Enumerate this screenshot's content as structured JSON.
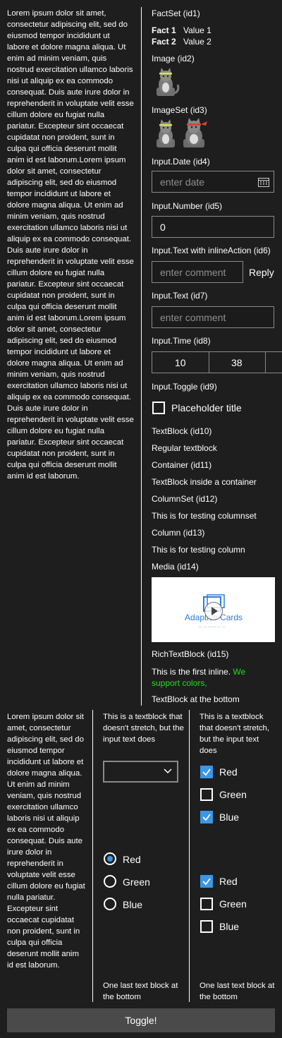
{
  "lorem_block": "Lorem ipsum dolor sit amet, consectetur adipiscing elit, sed do eiusmod tempor incididunt ut labore et dolore magna aliqua. Ut enim ad minim veniam, quis nostrud exercitation ullamco laboris nisi ut aliquip ex ea commodo consequat. Duis aute irure dolor in reprehenderit in voluptate velit esse cillum dolore eu fugiat nulla pariatur. Excepteur sint occaecat cupidatat non proident, sunt in culpa qui officia deserunt mollit anim id est laborum.Lorem ipsum dolor sit amet, consectetur adipiscing elit, sed do eiusmod tempor incididunt ut labore et dolore magna aliqua. Ut enim ad minim veniam, quis nostrud exercitation ullamco laboris nisi ut aliquip ex ea commodo consequat. Duis aute irure dolor in reprehenderit in voluptate velit esse cillum dolore eu fugiat nulla pariatur. Excepteur sint occaecat cupidatat non proident, sunt in culpa qui officia deserunt mollit anim id est laborum.Lorem ipsum dolor sit amet, consectetur adipiscing elit, sed do eiusmod tempor incididunt ut labore et dolore magna aliqua. Ut enim ad minim veniam, quis nostrud exercitation ullamco laboris nisi ut aliquip ex ea commodo consequat. Duis aute irure dolor in reprehenderit in voluptate velit esse cillum dolore eu fugiat nulla pariatur. Excepteur sint occaecat cupidatat non proident, sunt in culpa qui officia deserunt mollit anim id est laborum.",
  "lorem_short": "Lorem ipsum dolor sit amet, consectetur adipiscing elit, sed do eiusmod tempor incididunt ut labore et dolore magna aliqua. Ut enim ad minim veniam, quis nostrud exercitation ullamco laboris nisi ut aliquip ex ea commodo consequat. Duis aute irure dolor in reprehenderit in voluptate velit esse cillum dolore eu fugiat nulla pariatur. Excepteur sint occaecat cupidatat non proident, sunt in culpa qui officia deserunt mollit anim id est laborum.",
  "factset": {
    "heading": "FactSet (id1)",
    "facts": [
      {
        "title": "Fact 1",
        "value": "Value 1"
      },
      {
        "title": "Fact 2",
        "value": "Value 2"
      }
    ]
  },
  "image": {
    "heading": "Image (id2)"
  },
  "imageset": {
    "heading": "ImageSet (id3)"
  },
  "date": {
    "heading": "Input.Date (id4)",
    "placeholder": "enter date",
    "icon": "calendar-icon"
  },
  "number": {
    "heading": "Input.Number (id5)",
    "value": "0"
  },
  "inline_text": {
    "heading": "Input.Text with inlineAction (id6)",
    "placeholder": "enter comment",
    "action": "Reply"
  },
  "text": {
    "heading": "Input.Text (id7)",
    "placeholder": "enter comment"
  },
  "time": {
    "heading": "Input.Time (id8)",
    "hour": "10",
    "minute": "38"
  },
  "toggle": {
    "heading": "Input.Toggle (id9)",
    "title": "Placeholder title",
    "checked": false
  },
  "textblock": {
    "heading": "TextBlock (id10)",
    "text": "Regular textblock"
  },
  "container": {
    "heading": "Container (id11)",
    "text": "TextBlock inside a container"
  },
  "columnset": {
    "heading": "ColumnSet (id12)",
    "text": "This is for testing columnset"
  },
  "column": {
    "heading": "Column (id13)",
    "text": "This is for testing column"
  },
  "media": {
    "heading": "Media (id14)",
    "poster_text": "Adaptive Cards",
    "poster_sub": "— — — — — —"
  },
  "richtext": {
    "heading": "RichTextBlock (id15)",
    "part1": "This is the first inline. ",
    "part2_line1": "We",
    "part2_line2": "support colors,",
    "color_white": "#ffffff",
    "color_green": "#22dd22"
  },
  "bottom_text": "TextBlock at the bottom",
  "lower": {
    "col2_top": "This is a textblock that doesn't stretch, but the input text does",
    "col3_top": "This is a textblock that doesn't stretch, but the input text does",
    "dropdown_value": "",
    "radio_options": [
      {
        "label": "Red",
        "selected": true
      },
      {
        "label": "Green",
        "selected": false
      },
      {
        "label": "Blue",
        "selected": false
      }
    ],
    "checks_a": [
      {
        "label": "Red",
        "checked": true
      },
      {
        "label": "Green",
        "checked": false
      },
      {
        "label": "Blue",
        "checked": true
      }
    ],
    "checks_b": [
      {
        "label": "Red",
        "checked": true
      },
      {
        "label": "Green",
        "checked": false
      },
      {
        "label": "Blue",
        "checked": false
      }
    ],
    "col2_bottom": "One last text block at the bottom",
    "col3_bottom": "One last text block at the bottom"
  },
  "toggle_button": "Toggle!",
  "accent": "#3a96e6"
}
